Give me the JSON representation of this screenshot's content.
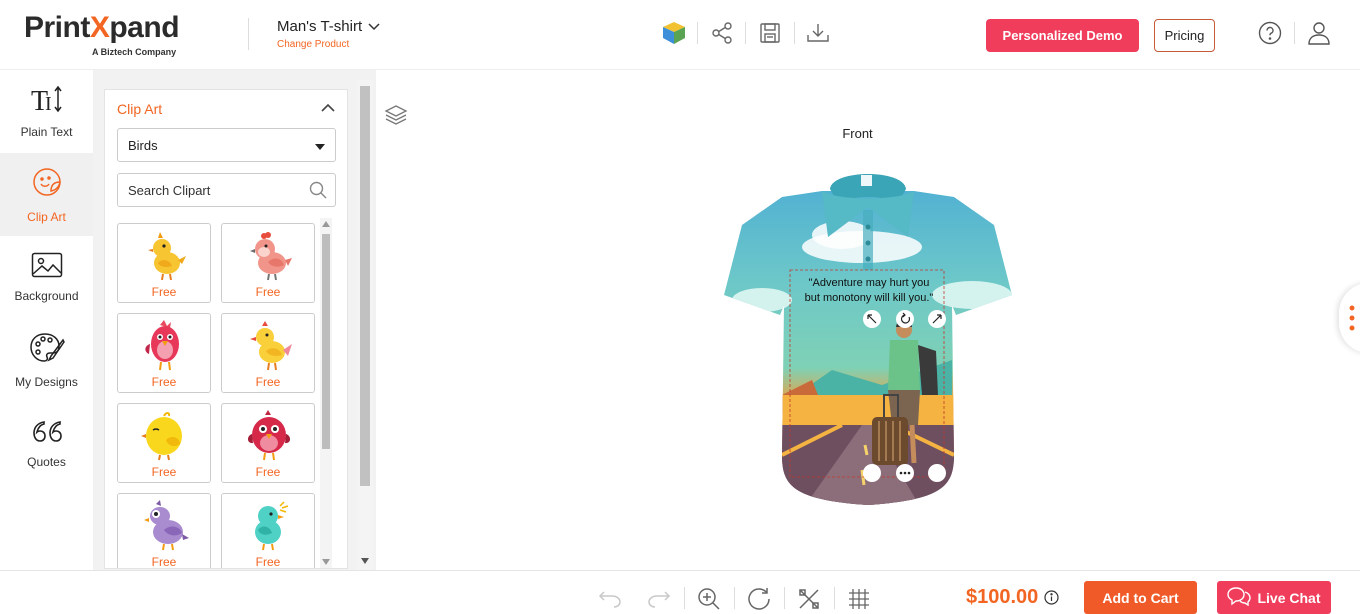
{
  "brand": {
    "logo_prefix": "Print",
    "logo_x": "X",
    "logo_suffix": "pand",
    "tagline": "A Biztech Company",
    "accent_color": "#f26522",
    "pink_color": "#ef3d5b"
  },
  "product": {
    "name": "Man's T-shirt",
    "change_label": "Change Product"
  },
  "header": {
    "icons": [
      "3d-cube-icon",
      "share-icon",
      "save-icon",
      "download-icon",
      "help-icon",
      "user-icon"
    ],
    "demo_label": "Personalized Demo",
    "pricing_label": "Pricing"
  },
  "sidebar": {
    "items": [
      {
        "label": "Plain Text",
        "icon": "text-size-icon",
        "active": false
      },
      {
        "label": "Clip Art",
        "icon": "sticker-icon",
        "active": true
      },
      {
        "label": "Background",
        "icon": "image-icon",
        "active": false
      },
      {
        "label": "My Designs",
        "icon": "palette-icon",
        "active": false
      },
      {
        "label": "Quotes",
        "icon": "quote-icon",
        "active": false
      }
    ]
  },
  "clipart": {
    "title": "Clip Art",
    "category": "Birds",
    "search_placeholder": "Search Clipart",
    "items": [
      {
        "label": "Free",
        "art": "yellow-chick"
      },
      {
        "label": "Free",
        "art": "pink-bird"
      },
      {
        "label": "Free",
        "art": "red-bird"
      },
      {
        "label": "Free",
        "art": "yellow-bird"
      },
      {
        "label": "Free",
        "art": "round-yellow-bird"
      },
      {
        "label": "Free",
        "art": "round-red-bird"
      },
      {
        "label": "Free",
        "art": "purple-bird"
      },
      {
        "label": "Free",
        "art": "teal-bird"
      }
    ]
  },
  "canvas": {
    "view_label": "Front",
    "quote_line1": "\"Adventure may hurt you",
    "quote_line2": "but monotony will kill you.\""
  },
  "footer": {
    "icons": [
      "undo-icon",
      "redo-icon",
      "zoom-in-icon",
      "reset-icon",
      "tools-icon",
      "grid-icon"
    ],
    "price": "$100.00",
    "add_to_cart_label": "Add to Cart",
    "live_chat_label": "Live Chat"
  }
}
